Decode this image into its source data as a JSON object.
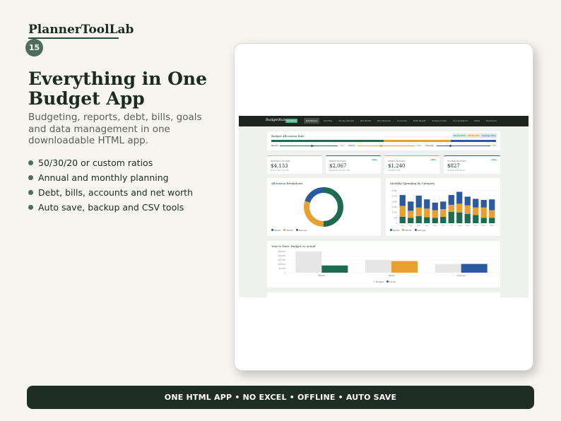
{
  "brand": "PlannerToolLab",
  "page_number": "15",
  "headline": "Everything in One Budget App",
  "subheadline": "Budgeting, reports, debt, bills, goals and data management in one downloadable HTML app.",
  "features": [
    "50/30/20 or custom ratios",
    "Annual and monthly planning",
    "Debt, bills, accounts and net worth",
    "Auto save, backup and CSV tools"
  ],
  "footer_banner": "ONE HTML APP  •  NO EXCEL  •  OFFLINE  •  AUTO SAVE",
  "colors": {
    "dark_green": "#1f2e24",
    "accent_green": "#4e6d5a",
    "needs": "#1f6b52",
    "wants": "#e8a030",
    "savings": "#2b5aa0"
  },
  "screenshot": {
    "app_name": "BudgetRule",
    "app_badge": "50/30/20",
    "nav_items": [
      "Dashboard",
      "Monthly",
      "Money Review",
      "Net Worth",
      "Bill Calendar",
      "Accounts",
      "Debt Payoff",
      "Sinking Funds",
      "Annual Report",
      "2024",
      "Download"
    ],
    "allocation_title": "Budget Allocation Rule",
    "allocation_pills": [
      "Needs 50%",
      "Wants 30%",
      "Savings 20%"
    ],
    "allocation": {
      "needs": 50,
      "wants": 30,
      "savings": 20
    },
    "slider_labels": [
      "Needs",
      "50%",
      "Wants",
      "30%",
      "Savings",
      "20%"
    ],
    "kpis": [
      {
        "label": "MONTHLY INCOME",
        "value": "$4,133",
        "note": "This month's income",
        "tag": ""
      },
      {
        "label": "NEEDS BUDGET",
        "value": "$2,067",
        "note": "Essentials & fixed costs",
        "tag": "50%"
      },
      {
        "label": "WANTS BUDGET",
        "value": "$1,240",
        "note": "Lifestyle & fun",
        "tag": "30%"
      },
      {
        "label": "SAVINGS BUDGET",
        "value": "$827",
        "note": "Goals & debt payoff",
        "tag": "20%"
      }
    ],
    "donut_title": "Allocation Breakdown",
    "bars_title": "Monthly Spending by Category",
    "legend": [
      "Needs",
      "Wants",
      "Savings"
    ],
    "months": [
      "Jan",
      "Feb",
      "Mar",
      "Apr",
      "May",
      "Jun",
      "Jul",
      "Aug",
      "Sep",
      "Oct",
      "Nov",
      "Dec"
    ],
    "y_ticks": [
      "3,000",
      "2,500",
      "2,000",
      "1,500",
      "1,000",
      "500",
      "0"
    ],
    "ytd_title": "Year-to-Date: Budget vs Actual",
    "ytd_ticks": [
      "$25,000",
      "$20,000",
      "$15,000",
      "$10,000",
      "$5,000",
      "0"
    ],
    "ytd_categories": [
      "Needs",
      "Wants",
      "Savings"
    ],
    "ytd_legend": [
      "Budget",
      "Actual"
    ]
  },
  "chart_data": [
    {
      "type": "pie",
      "title": "Allocation Breakdown",
      "categories": [
        "Needs",
        "Wants",
        "Savings"
      ],
      "values": [
        50,
        30,
        20
      ]
    },
    {
      "type": "bar",
      "title": "Monthly Spending by Category",
      "categories": [
        "Jan",
        "Feb",
        "Mar",
        "Apr",
        "May",
        "Jun",
        "Jul",
        "Aug",
        "Sep",
        "Oct",
        "Nov",
        "Dec"
      ],
      "series": [
        {
          "name": "Needs",
          "values": [
            600,
            500,
            650,
            550,
            500,
            600,
            1050,
            1000,
            850,
            750,
            500,
            500
          ]
        },
        {
          "name": "Wants",
          "values": [
            1000,
            650,
            800,
            800,
            700,
            700,
            650,
            800,
            800,
            700,
            950,
            700
          ]
        },
        {
          "name": "Savings",
          "values": [
            1000,
            850,
            1100,
            850,
            700,
            700,
            900,
            1100,
            800,
            800,
            700,
            1000
          ]
        }
      ],
      "ylim": [
        0,
        3000
      ]
    },
    {
      "type": "bar",
      "title": "Year-to-Date: Budget vs Actual",
      "categories": [
        "Needs",
        "Wants",
        "Savings"
      ],
      "series": [
        {
          "name": "Budget",
          "values": [
            24800,
            14900,
            9900
          ]
        },
        {
          "name": "Actual",
          "values": [
            8500,
            13700,
            10300
          ]
        }
      ],
      "ylim": [
        0,
        25000
      ]
    }
  ]
}
